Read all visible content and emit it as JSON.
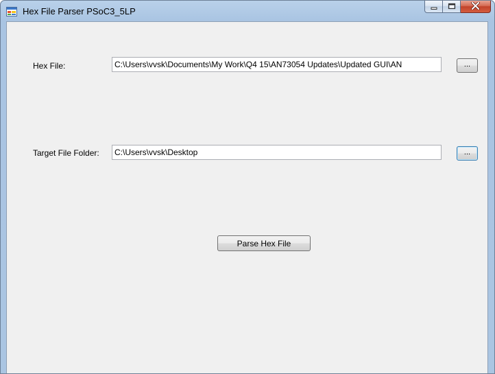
{
  "window": {
    "title": "Hex File Parser PSoC3_5LP",
    "app_icon": "windows-form-icon",
    "controls": {
      "minimize_icon": "minimize-icon",
      "maximize_icon": "maximize-icon",
      "close_icon": "close-icon"
    }
  },
  "form": {
    "hex_file": {
      "label": "Hex File:",
      "value": "C:\\Users\\vvsk\\Documents\\My Work\\Q4 15\\AN73054 Updates\\Updated GUI\\AN",
      "browse_label": "..."
    },
    "target_folder": {
      "label": "Target File Folder:",
      "value": "C:\\Users\\vvsk\\Desktop",
      "browse_label": "..."
    },
    "parse_button_label": "Parse Hex File"
  },
  "colors": {
    "frame": "#aac5e2",
    "client": "#f0f0f0",
    "close_button": "#c2432b"
  }
}
